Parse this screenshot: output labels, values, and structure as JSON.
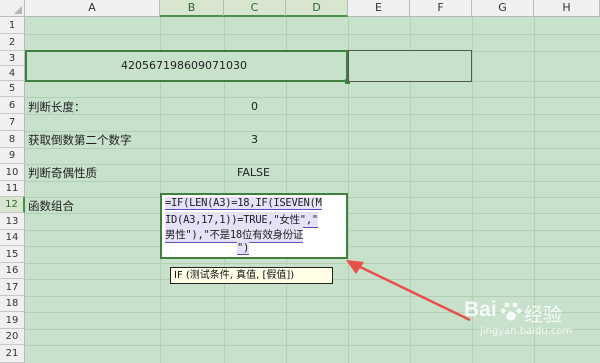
{
  "columns": [
    "A",
    "B",
    "C",
    "D",
    "E",
    "F",
    "G",
    "H"
  ],
  "rows": [
    "1",
    "2",
    "3",
    "4",
    "5",
    "6",
    "7",
    "8",
    "9",
    "10",
    "11",
    "12",
    "13",
    "14",
    "15",
    "16",
    "17",
    "18",
    "19",
    "20",
    "21"
  ],
  "selected_row": "12",
  "cells": {
    "a3": "420567198609071030",
    "a6": "判断长度：",
    "c6": "0",
    "a8": "获取倒数第二个数字",
    "c8": "3",
    "a10": "判断奇偶性质",
    "c10": "FALSE",
    "a12": "函数组合"
  },
  "formula": {
    "lines": [
      "=IF(LEN(A3)=18,IF(ISEVEN(M",
      "ID(A3,17,1))=TRUE,\"女性\",\"",
      "男性\"),\"不是18位有效身份证",
      "\")"
    ]
  },
  "tooltip": {
    "text": "IF (测试条件, 真值, [假值])"
  },
  "watermark": {
    "brand": "Bai",
    "brand2": "经验",
    "sub": "jingyan.baidu.com"
  },
  "colors": {
    "sheet_bg": "#c7e1cb",
    "selection": "#3f7f3f",
    "arrow": "#e8504a"
  }
}
